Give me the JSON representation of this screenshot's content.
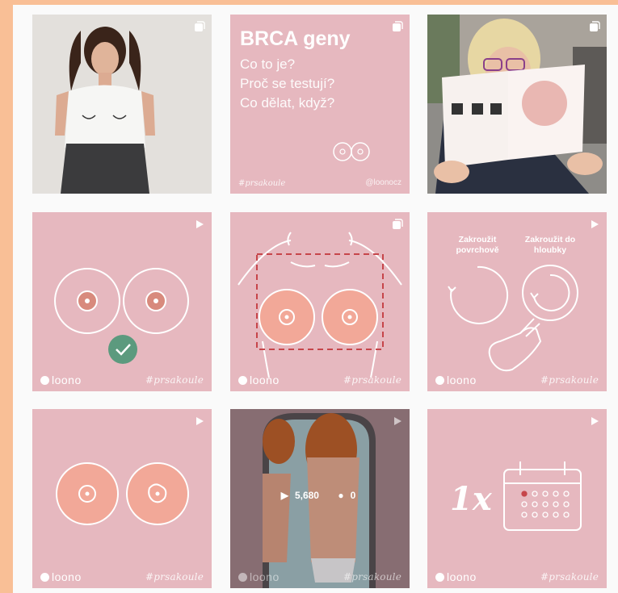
{
  "grid": {
    "tile1": {
      "alt_icon": "carousel-icon"
    },
    "tile2": {
      "title": "BRCA geny",
      "lines": [
        "Co to je?",
        "Proč se testují?",
        "Co dělat, když?"
      ],
      "hashtag": "#prsakoule",
      "handle": "@loonocz",
      "icon": "carousel-icon"
    },
    "tile3": {
      "icon": "carousel-icon"
    },
    "tile4": {
      "brand": "loono",
      "hashtag": "#prsakoule",
      "icon": "video-icon"
    },
    "tile5": {
      "brand": "loono",
      "hashtag": "#prsakoule",
      "icon": "carousel-icon"
    },
    "tile6": {
      "label_left": "Zakroužit povrchově",
      "label_right": "Zakroužit do hloubky",
      "brand": "loono",
      "hashtag": "#prsakoule",
      "icon": "video-icon"
    },
    "tile7": {
      "brand": "loono",
      "hashtag": "#prsakoule",
      "icon": "video-icon"
    },
    "tile8": {
      "plays": "5,680",
      "comments": "0",
      "brand": "loono",
      "hashtag": "#prsakoule",
      "icon": "video-icon"
    },
    "tile9": {
      "count": "1x",
      "brand": "loono",
      "hashtag": "#prsakoule",
      "icon": "video-icon"
    }
  },
  "colors": {
    "frame": "#f9bf96",
    "tile_pink": "#e6b8bf",
    "check_green": "#5c9a7e",
    "nipple": "#f2a898"
  }
}
